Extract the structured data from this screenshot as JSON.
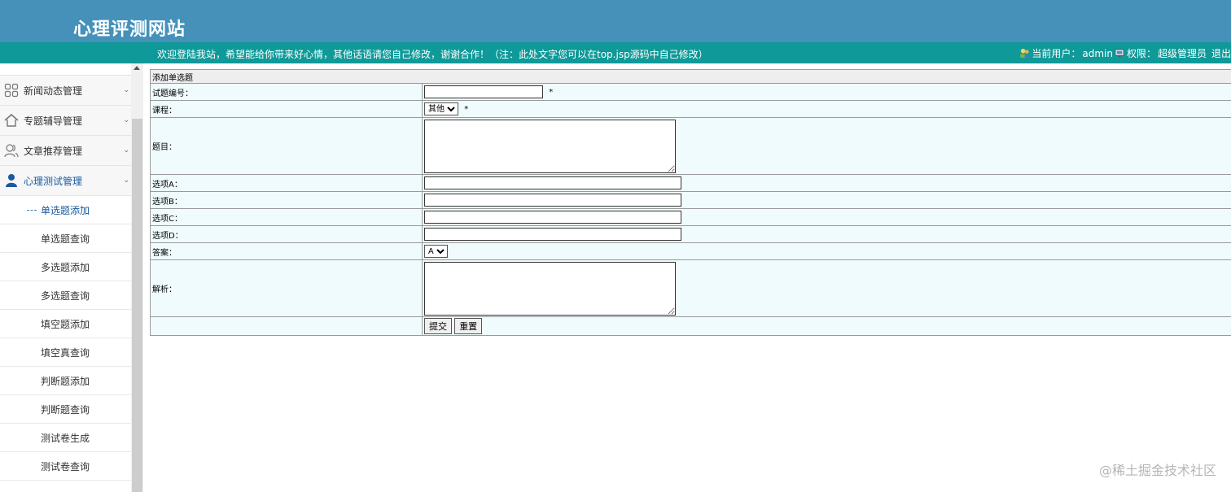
{
  "header": {
    "site_title": "心理评测网站",
    "welcome": "欢迎登陆我站，希望能给你带来好心情，其他话语请您自己修改，谢谢合作！（注：此处文字您可以在top.jsp源码中自己修改）",
    "user_label": "当前用户：",
    "user_name": "admin",
    "perm_label": "权限：",
    "perm_value": "超级管理员",
    "logout": "退出"
  },
  "sidebar": {
    "menus": [
      {
        "label": "新闻动态管理",
        "icon": "grid-icon"
      },
      {
        "label": "专题辅导管理",
        "icon": "home-icon"
      },
      {
        "label": "文章推荐管理",
        "icon": "users-icon"
      },
      {
        "label": "心理测试管理",
        "icon": "user-icon"
      }
    ],
    "submenu": [
      "单选题添加",
      "单选题查询",
      "多选题添加",
      "多选题查询",
      "填空题添加",
      "填空真查询",
      "判断题添加",
      "判断题查询",
      "测试卷生成",
      "测试卷查询"
    ]
  },
  "form": {
    "title": "添加单选题",
    "fields": {
      "id_label": "试题编号：",
      "course_label": "课程：",
      "course_value": "其他",
      "question_label": "题目：",
      "a_label": "选项A：",
      "b_label": "选项B：",
      "c_label": "选项C：",
      "d_label": "选项D：",
      "answer_label": "答案：",
      "answer_value": "A",
      "analysis_label": "解析："
    },
    "required_mark": "*",
    "submit": "提交",
    "reset": "重置"
  },
  "watermark": "@稀土掘金技术社区",
  "colors": {
    "header": "#4591ba",
    "topbar": "#0f9999",
    "row": "#f0fbfd"
  }
}
